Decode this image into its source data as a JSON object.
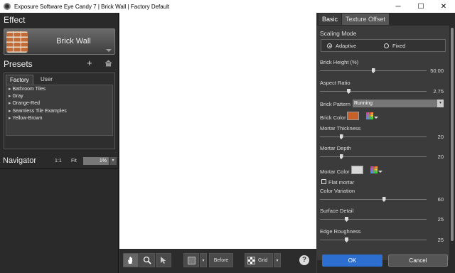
{
  "window": {
    "title": "Exposure Software Eye Candy 7 | Brick Wall | Factory Default",
    "minimize": "─",
    "maximize": "☐",
    "close": "✕"
  },
  "effect": {
    "heading": "Effect",
    "name": "Brick Wall"
  },
  "presets": {
    "heading": "Presets",
    "add_glyph": "+",
    "tabs": [
      "Factory",
      "User"
    ],
    "items": [
      "Bathroom Tiles",
      "Gray",
      "Orange-Red",
      "Seamless Tile Examples",
      "Yellow-Brown"
    ]
  },
  "navigator": {
    "heading": "Navigator",
    "one_to_one": "1:1",
    "fit": "Fit",
    "zoom": "1%",
    "dropdown_glyph": "▾"
  },
  "toolbar": {
    "before_label": "Before",
    "grid_label": "Grid",
    "help_glyph": "?"
  },
  "right_panel": {
    "tabs": [
      "Basic",
      "Texture Offset"
    ],
    "scaling_mode": {
      "label": "Scaling Mode",
      "options": [
        "Adaptive",
        "Fixed"
      ],
      "selected": "Adaptive"
    },
    "brick_height": {
      "label": "Brick Height (%)",
      "value": "50.00",
      "fraction": 0.5
    },
    "aspect_ratio": {
      "label": "Aspect Ratio",
      "value": "2.75",
      "fraction": 0.27
    },
    "brick_pattern": {
      "label": "Brick Pattern",
      "value": "Running"
    },
    "brick_color": {
      "label": "Brick Color",
      "color": "#c8602a"
    },
    "mortar_thickness": {
      "label": "Mortar Thickness",
      "value": "20",
      "fraction": 0.2
    },
    "mortar_depth": {
      "label": "Mortar Depth",
      "value": "20",
      "fraction": 0.2
    },
    "mortar_color": {
      "label": "Mortar Color",
      "color": "#d8d8d8"
    },
    "flat_mortar": {
      "label": "Flat mortar",
      "checked": false
    },
    "color_variation": {
      "label": "Color Variation",
      "value": "60",
      "fraction": 0.6
    },
    "surface_detail": {
      "label": "Surface Detail",
      "value": "25",
      "fraction": 0.25
    },
    "edge_roughness": {
      "label": "Edge Roughness",
      "value": "25",
      "fraction": 0.25
    }
  },
  "dialog": {
    "ok": "OK",
    "cancel": "Cancel"
  },
  "colors": {
    "accent_blue": "#2d6fd0",
    "panel": "#3b3b3b"
  }
}
